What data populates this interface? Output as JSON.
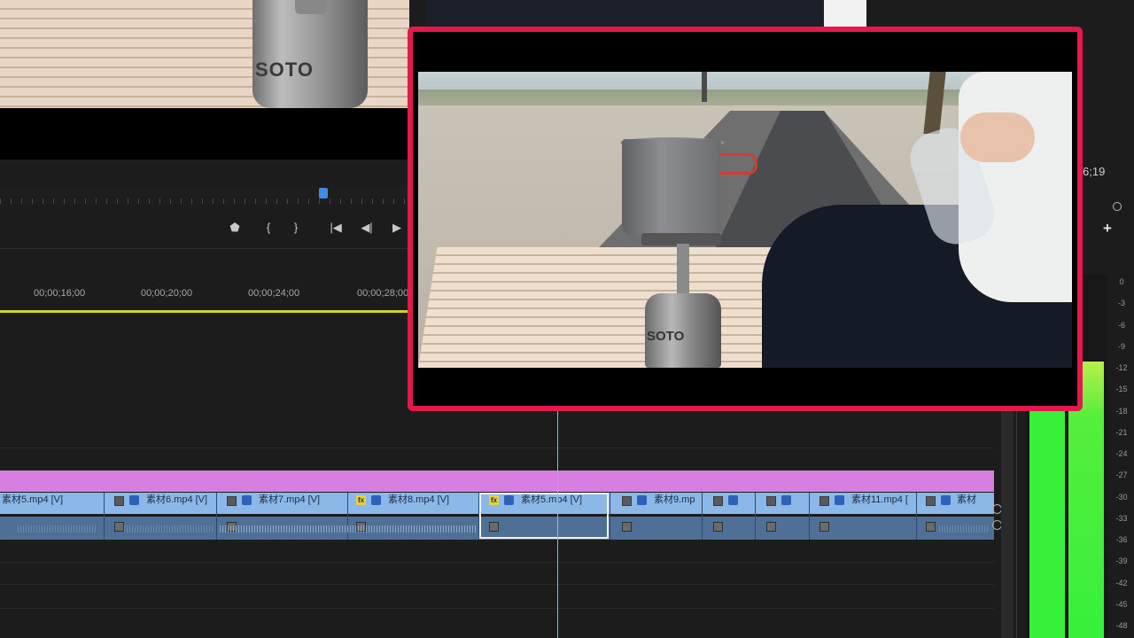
{
  "program_monitor": {
    "canister_brand": "SOTO",
    "timecode_right": "6;19"
  },
  "transport_controls": [
    {
      "name": "add-marker",
      "icon": "marker-icon",
      "glyph": "⬟"
    },
    {
      "name": "mark-in",
      "icon": "mark-in-icon",
      "glyph": "{"
    },
    {
      "name": "mark-out",
      "icon": "mark-out-icon",
      "glyph": "}"
    },
    {
      "name": "go-to-in",
      "icon": "go-to-in-icon",
      "glyph": "|◀"
    },
    {
      "name": "step-back",
      "icon": "step-back-icon",
      "glyph": "◀|"
    },
    {
      "name": "play",
      "icon": "play-icon",
      "glyph": "▶"
    }
  ],
  "timeline": {
    "ruler_labels": [
      "00;00;16;00",
      "00;00;20;00",
      "00;00;24;00",
      "00;00;28;00"
    ],
    "video_clips": [
      "素材5.mp4 [V]",
      "素材6.mp4 [V]",
      "素材7.mp4 [V]",
      "素材8.mp4 [V]",
      "素材5.mp4 [V]",
      "素材9.mp",
      "素材11.mp4 [",
      "素材"
    ],
    "fx_badge": "fx"
  },
  "audio_meter": {
    "scale": [
      "0",
      "-3",
      "-6",
      "-9",
      "-12",
      "-15",
      "-18",
      "-21",
      "-24",
      "-27",
      "-30",
      "-33",
      "-36",
      "-39",
      "-42",
      "-45",
      "-48"
    ]
  },
  "source_preview": {
    "canister_brand": "SOTO",
    "border_color": "#e3194b"
  },
  "colors": {
    "playhead": "#3b8de6",
    "magenta_track": "#d77fe0",
    "video_track": "#8bb8e8",
    "meter_green": "#36f03a"
  }
}
